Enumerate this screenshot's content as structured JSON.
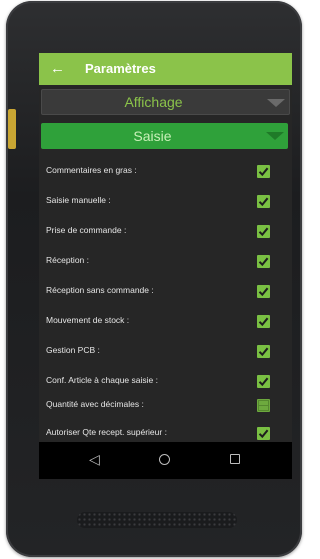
{
  "header": {
    "back_icon": "←",
    "title": "Paramètres",
    "color": "#8bc34a"
  },
  "sections": {
    "affichage": "Affichage",
    "saisie": "Saisie"
  },
  "settings": [
    {
      "label": "Commentaires en gras :",
      "checked": true
    },
    {
      "label": "Saisie manuelle :",
      "checked": true
    },
    {
      "label": "Prise de commande :",
      "checked": true
    },
    {
      "label": "Réception :",
      "checked": true
    },
    {
      "label": "Réception sans commande :",
      "checked": true
    },
    {
      "label": "Mouvement de stock :",
      "checked": true
    },
    {
      "label": "Gestion PCB :",
      "checked": true
    },
    {
      "label": "Conf. Article à chaque saisie :",
      "checked": true
    },
    {
      "label": "Quantité avec décimales :",
      "checked": false
    },
    {
      "label": "Autoriser Qte recept. supérieur :",
      "checked": true
    }
  ],
  "navbar": {
    "back_icon": "◁",
    "home_icon": "circle-home-icon",
    "recent_icon": "square-recent-icon"
  }
}
